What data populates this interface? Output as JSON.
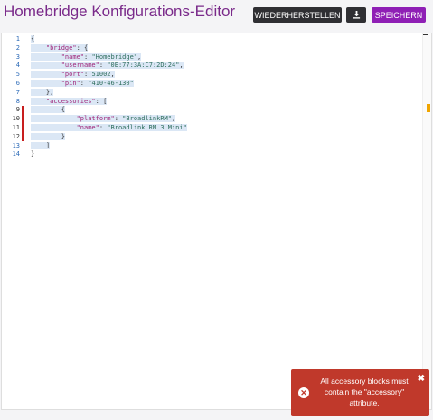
{
  "header": {
    "title": "Homebridge Konfigurations-Editor",
    "restore_label": "WIEDERHERSTELLEN",
    "download_icon": "download-icon",
    "save_label": "SPEICHERN"
  },
  "editor": {
    "line_numbers": [
      "1",
      "2",
      "3",
      "4",
      "5",
      "6",
      "7",
      "8",
      "9",
      "10",
      "11",
      "12",
      "13",
      "14"
    ],
    "error_lines": [
      9,
      10,
      11,
      12
    ],
    "lines": [
      "{",
      "    \"bridge\": {",
      "        \"name\": \"Homebridge\",",
      "        \"username\": \"0E:77:3A:C7:2D:24\",",
      "        \"port\": 51002,",
      "        \"pin\": \"410-46-130\"",
      "    },",
      "    \"accessories\": [",
      "        {",
      "            \"platform\": \"BroadlinkRM\",",
      "            \"name\": \"Broadlink RM 3 Mini\"",
      "        }",
      "    ]",
      "}"
    ]
  },
  "toast": {
    "message": "All accessory blocks must contain the \"accessory\" attribute.",
    "icon": "error-circle-icon",
    "close_icon": "close-icon",
    "color": "#c0392b"
  },
  "colors": {
    "title": "#7a2a8a",
    "save_button": "#8f1fb5",
    "dark_button": "#2f2f33",
    "error_marker": "#c81e1e"
  }
}
